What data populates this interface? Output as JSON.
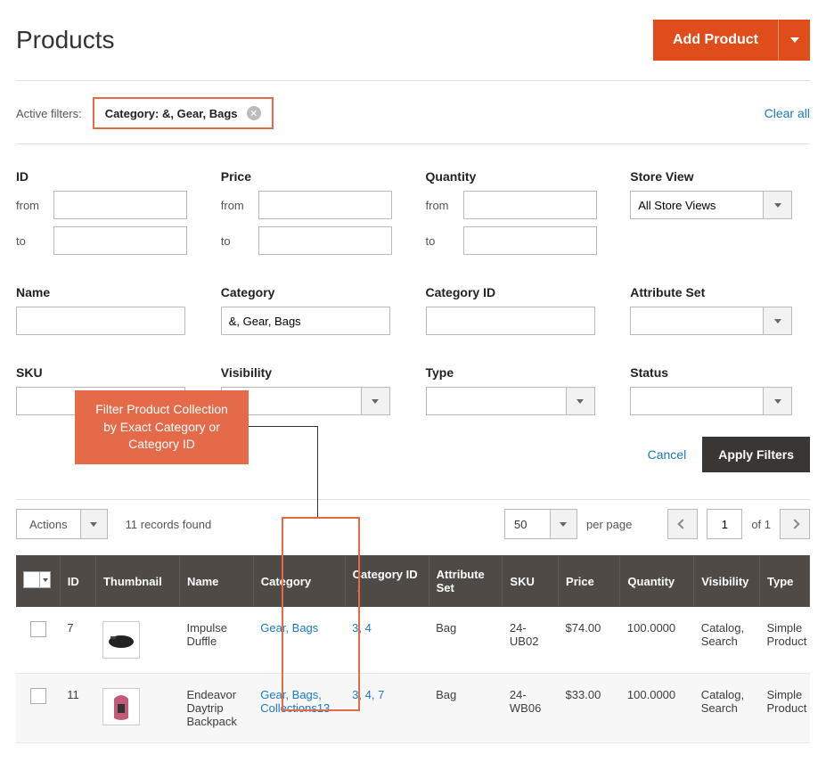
{
  "header": {
    "title": "Products",
    "add_label": "Add Product"
  },
  "active_filters": {
    "label": "Active filters:",
    "chip_label": "Category:",
    "chip_value": "&, Gear, Bags",
    "clear_all": "Clear all"
  },
  "filters": {
    "id": {
      "label": "ID",
      "from_label": "from",
      "to_label": "to"
    },
    "price": {
      "label": "Price",
      "from_label": "from",
      "to_label": "to"
    },
    "quantity": {
      "label": "Quantity",
      "from_label": "from",
      "to_label": "to"
    },
    "store_view": {
      "label": "Store View",
      "value": "All Store Views"
    },
    "name": {
      "label": "Name"
    },
    "category": {
      "label": "Category",
      "value": "&, Gear, Bags"
    },
    "category_id": {
      "label": "Category ID"
    },
    "attribute_set": {
      "label": "Attribute Set"
    },
    "sku": {
      "label": "SKU"
    },
    "visibility": {
      "label": "Visibility"
    },
    "type": {
      "label": "Type"
    },
    "status": {
      "label": "Status"
    }
  },
  "filter_actions": {
    "cancel": "Cancel",
    "apply": "Apply Filters"
  },
  "callout": {
    "text": "Filter Product Collection by Exact Category or Category ID"
  },
  "toolbar": {
    "actions_label": "Actions",
    "records_found": "11 records found",
    "per_page_value": "50",
    "per_page_label": "per page",
    "page_value": "1",
    "of_label": "of 1"
  },
  "columns": {
    "id": "ID",
    "thumbnail": "Thumbnail",
    "name": "Name",
    "category": "Category",
    "category_id": "Category ID",
    "attribute_set": "Attribute Set",
    "sku": "SKU",
    "price": "Price",
    "quantity": "Quantity",
    "visibility": "Visibility",
    "type": "Type"
  },
  "rows": [
    {
      "id": "7",
      "name": "Impulse Duffle",
      "category": "Gear, Bags",
      "category_id": "3, 4",
      "attribute_set": "Bag",
      "sku": "24-UB02",
      "price": "$74.00",
      "quantity": "100.0000",
      "visibility": "Catalog, Search",
      "type": "Simple Product"
    },
    {
      "id": "11",
      "name": "Endeavor Daytrip Backpack",
      "category": "Gear, Bags, Collections13",
      "category_id": "3, 4, 7",
      "attribute_set": "Bag",
      "sku": "24-WB06",
      "price": "$33.00",
      "quantity": "100.0000",
      "visibility": "Catalog, Search",
      "type": "Simple Product"
    }
  ]
}
